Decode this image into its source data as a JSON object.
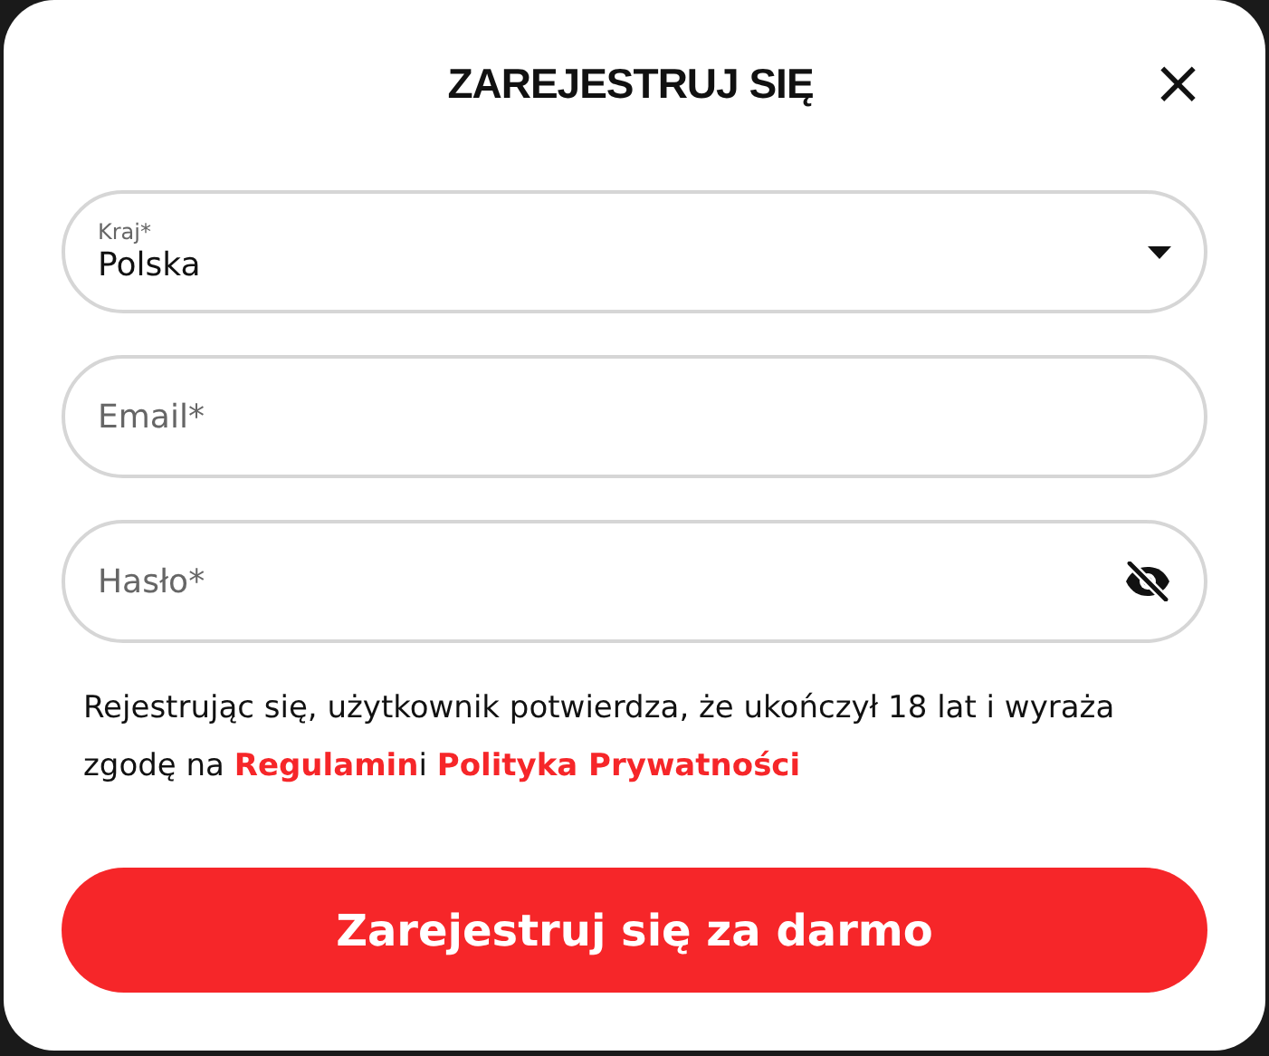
{
  "dialog": {
    "title": "ZAREJESTRUJ SIĘ",
    "close": "×"
  },
  "fields": [
    {
      "kind": "select",
      "label": "Kraj*",
      "value": "Polska"
    },
    {
      "kind": "input",
      "placeholder": "Email*"
    },
    {
      "kind": "password",
      "placeholder": "Hasło*"
    }
  ],
  "consent": [
    {
      "kind": "text",
      "text": "Rejestrując się, użytkownik potwierdza, że ukończył 18 lat i wyraża zgodę na "
    },
    {
      "kind": "link",
      "text": "Regulamin"
    },
    {
      "kind": "text",
      "text": "i "
    },
    {
      "kind": "link",
      "text": "Polityka Prywatności"
    }
  ],
  "submit": "Zarejestruj się za darmo"
}
